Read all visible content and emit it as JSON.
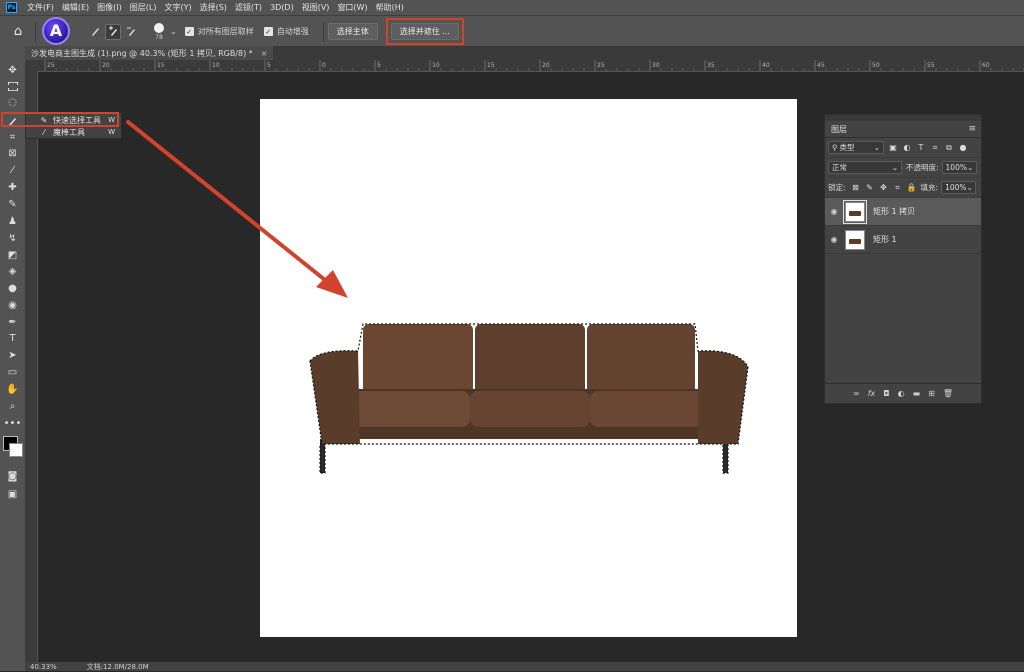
{
  "menubar": {
    "logo": "Ps",
    "items": [
      "文件(F)",
      "编辑(E)",
      "图像(I)",
      "图层(L)",
      "文字(Y)",
      "选择(S)",
      "滤镜(T)",
      "3D(D)",
      "视图(V)",
      "窗口(W)",
      "帮助(H)"
    ]
  },
  "options": {
    "badge_letter": "A",
    "brush_size": "78",
    "sample_all_layers": "对所有图层取样",
    "auto_enhance": "自动增强",
    "select_subject": "选择主体",
    "select_and_mask": "选择并遮住 ..."
  },
  "document": {
    "tab_title": "沙发电商主图生成 (1).png @ 40.3% (矩形 1 拷贝, RGB/8) *",
    "close_glyph": "×"
  },
  "ruler_labels": [
    "25",
    "20",
    "15",
    "10",
    "5",
    "0",
    "5",
    "10",
    "15",
    "20",
    "25",
    "30",
    "35",
    "40",
    "45",
    "50",
    "55",
    "60",
    "65",
    "70"
  ],
  "flyout": {
    "items": [
      {
        "label": "快速选择工具",
        "key": "W"
      },
      {
        "label": "魔棒工具",
        "key": "W"
      }
    ]
  },
  "layers_panel": {
    "title": "图层",
    "filter_label": "类型",
    "blend_mode": "正常",
    "opacity_label": "不透明度:",
    "opacity_value": "100%",
    "lock_label": "锁定:",
    "fill_label": "填充:",
    "fill_value": "100%",
    "layers": [
      {
        "name": "矩形 1 拷贝",
        "selected": true
      },
      {
        "name": "矩形 1",
        "selected": false
      }
    ],
    "footer_icons": [
      "link-icon",
      "fx-icon",
      "mask-icon",
      "adjustment-icon",
      "group-icon",
      "new-layer-icon",
      "trash-icon"
    ]
  },
  "status": {
    "zoom": "40.33%",
    "doc_info": "文档:12.0M/28.0M"
  },
  "colors": {
    "highlight": "#d0442f",
    "sofa": "#5e3f2d"
  }
}
